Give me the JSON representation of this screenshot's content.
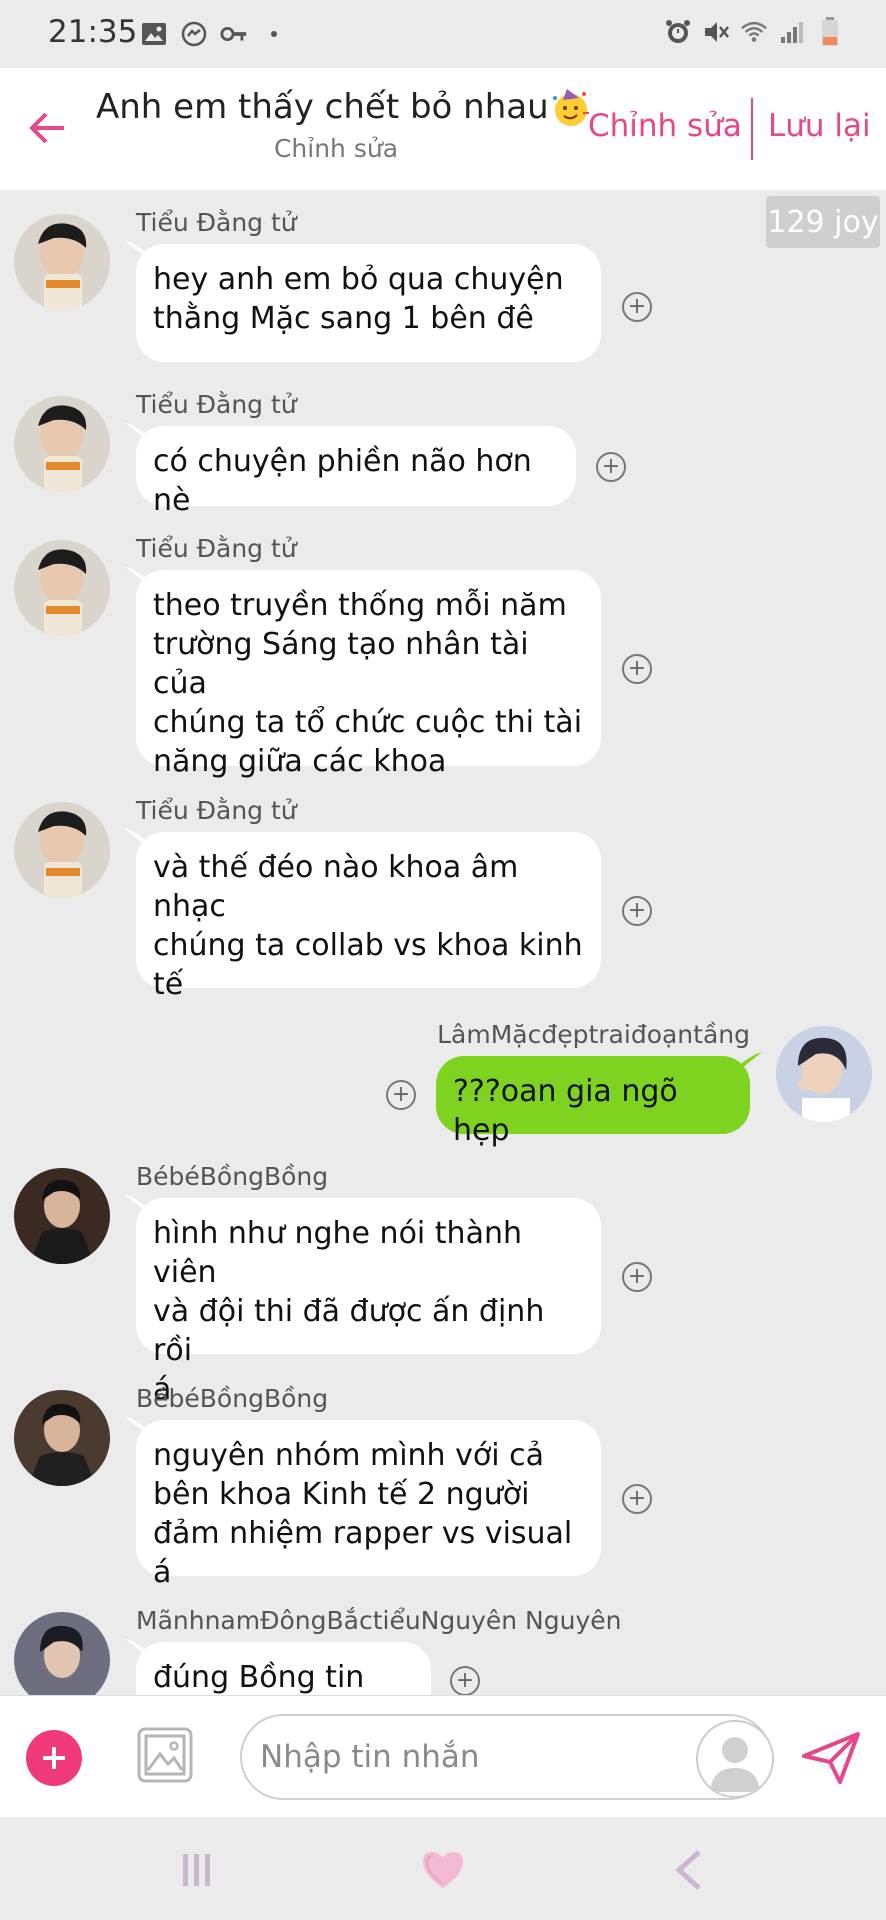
{
  "status_bar": {
    "time": "21:35",
    "left_icons": [
      "gallery-icon",
      "messenger-icon",
      "key-icon",
      "dot-icon"
    ],
    "right_icons": [
      "alarm-icon",
      "mute-icon",
      "wifi-icon",
      "signal-icon",
      "battery-icon"
    ]
  },
  "header": {
    "title": "Anh em thấy chết bỏ nhau",
    "title_emoji": "party-face-icon",
    "subtitle": "Chỉnh sửa",
    "edit_label": "Chỉnh sửa",
    "save_label": "Lưu lại",
    "accent_color": "#e5478a"
  },
  "chat": {
    "joy_badge": "129 joy",
    "messages": [
      {
        "sender": "Tiểu Đằng tử",
        "lines": [
          "hey anh em bỏ qua chuyện",
          "thằng Mặc sang 1 bên đê"
        ],
        "mine": false
      },
      {
        "sender": "Tiểu Đằng tử",
        "lines": [
          "có chuyện phiền não hơn nè"
        ],
        "mine": false
      },
      {
        "sender": "Tiểu Đằng tử",
        "lines": [
          "theo truyền thống mỗi năm",
          "trường Sáng tạo nhân tài của",
          "chúng ta tổ chức cuộc thi tài",
          "năng giữa các khoa"
        ],
        "mine": false
      },
      {
        "sender": "Tiểu Đằng tử",
        "lines": [
          "và thế đéo nào khoa âm nhạc",
          "chúng ta collab vs khoa kinh",
          "tế"
        ],
        "mine": false
      },
      {
        "sender": "LâmMặcđẹptraiđoạntầng",
        "lines": [
          "???oan gia ngõ hẹp"
        ],
        "mine": true
      },
      {
        "sender": "BébéBồngBồng",
        "lines": [
          "hình như nghe nói thành viên",
          "và đội thi đã được ấn định rồi",
          "á"
        ],
        "mine": false
      },
      {
        "sender": "BébéBồngBồng",
        "lines": [
          "nguyên nhóm mình với cả",
          "bên khoa Kinh tế 2 người",
          "đảm nhiệm rapper vs visual á"
        ],
        "mine": false
      },
      {
        "sender": "MãnhnamĐôngBắctiểuNguyên Nguyên",
        "lines": [
          "đúng Bồng tin tức"
        ],
        "mine": false
      }
    ],
    "mine_bubble_color": "#7ed321"
  },
  "input_bar": {
    "placeholder": "Nhập tin nhắn",
    "add_color": "#f0397a"
  },
  "nav_bar": {
    "icons": [
      "recent-apps-icon",
      "home-heart-icon",
      "back-icon"
    ]
  }
}
